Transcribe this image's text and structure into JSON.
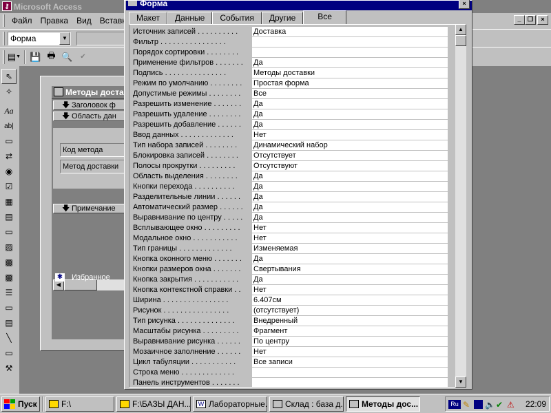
{
  "app": {
    "title": "Microsoft Access",
    "icon": "access-key-icon"
  },
  "menu": {
    "items": [
      "Файл",
      "Правка",
      "Вид",
      "Вставка"
    ]
  },
  "toolbar": {
    "object_combo": "Форма"
  },
  "form_window": {
    "title": "Методы доста",
    "sections": {
      "header": "Заголовок ф",
      "detail": "Область дан",
      "footer": "Примечание"
    },
    "fields": [
      "Код метода",
      "Метод доставки"
    ],
    "favorites": "Избранное"
  },
  "property_sheet": {
    "title": "Форма",
    "tabs": [
      "Макет",
      "Данные",
      "События",
      "Другие",
      "Все"
    ],
    "active_tab": "Все",
    "properties": [
      {
        "name": "Источник записей . . . . . . . . . .",
        "value": "Доставка"
      },
      {
        "name": "Фильтр . . . . . . . . . . . . . . . .",
        "value": ""
      },
      {
        "name": "Порядок сортировки . . . . . . . .",
        "value": ""
      },
      {
        "name": "Применение фильтров . . . . . . .",
        "value": "Да"
      },
      {
        "name": "Подпись . . . . . . . . . . . . . . .",
        "value": "Методы доставки"
      },
      {
        "name": "Режим по умолчанию . . . . . . . .",
        "value": "Простая форма"
      },
      {
        "name": "Допустимые режимы . . . . . . . .",
        "value": "Все"
      },
      {
        "name": "Разрешить изменение . . . . . . .",
        "value": "Да"
      },
      {
        "name": "Разрешить удаление . . . . . . . .",
        "value": "Да"
      },
      {
        "name": "Разрешить добавление . . . . . .",
        "value": "Да"
      },
      {
        "name": "Ввод данных . . . . . . . . . . . . .",
        "value": "Нет"
      },
      {
        "name": "Тип набора записей . . . . . . . .",
        "value": "Динамический набор"
      },
      {
        "name": "Блокировка записей . . . . . . . .",
        "value": "Отсутствует"
      },
      {
        "name": "Полосы прокрутки . . . . . . . . .",
        "value": "Отсутствуют"
      },
      {
        "name": "Область выделения . . . . . . . .",
        "value": "Да"
      },
      {
        "name": "Кнопки перехода . . . . . . . . . .",
        "value": "Да"
      },
      {
        "name": "Разделительные линии . . . . . .",
        "value": "Да"
      },
      {
        "name": "Автоматический размер . . . . . .",
        "value": "Да"
      },
      {
        "name": "Выравнивание по центру . . . . .",
        "value": "Да"
      },
      {
        "name": "Всплывающее окно . . . . . . . . .",
        "value": "Нет"
      },
      {
        "name": "Модальное окно . . . . . . . . . . .",
        "value": "Нет"
      },
      {
        "name": "Тип границы . . . . . . . . . . . . .",
        "value": "Изменяемая"
      },
      {
        "name": "Кнопка оконного меню . . . . . . .",
        "value": "Да"
      },
      {
        "name": "Кнопки размеров окна . . . . . . .",
        "value": "Свертывания"
      },
      {
        "name": "Кнопка закрытия . . . . . . . . . . .",
        "value": "Да"
      },
      {
        "name": "Кнопка контекстной справки . .",
        "value": "Нет"
      },
      {
        "name": "Ширина . . . . . . . . . . . . . . . .",
        "value": "6.407см"
      },
      {
        "name": "Рисунок . . . . . . . . . . . . . . . .",
        "value": "(отсутствует)"
      },
      {
        "name": "Тип рисунка . . . . . . . . . . . . . .",
        "value": "Внедренный"
      },
      {
        "name": "Масштабы рисунка . . . . . . . . .",
        "value": "Фрагмент"
      },
      {
        "name": "Выравнивание рисунка . . . . . .",
        "value": "По центру"
      },
      {
        "name": "Мозаичное заполнение . . . . . .",
        "value": "Нет"
      },
      {
        "name": "Цикл табуляции . . . . . . . . . . .",
        "value": "Все записи"
      },
      {
        "name": "Строка меню . . . . . . . . . . . . .",
        "value": ""
      },
      {
        "name": "Панель инструментов . . . . . . .",
        "value": ""
      }
    ]
  },
  "taskbar": {
    "start": "Пуск",
    "buttons": [
      {
        "label": "F:\\",
        "icon": "folder-icon"
      },
      {
        "label": "F:\\БАЗЫ ДАН...",
        "icon": "folder-icon"
      },
      {
        "label": "Лабораторные...",
        "icon": "word-icon"
      },
      {
        "label": "Склад : база д...",
        "icon": "database-icon"
      },
      {
        "label": "Методы дос...",
        "icon": "form-icon"
      }
    ],
    "tray": {
      "language": "Ru",
      "clock": "22:09"
    }
  }
}
